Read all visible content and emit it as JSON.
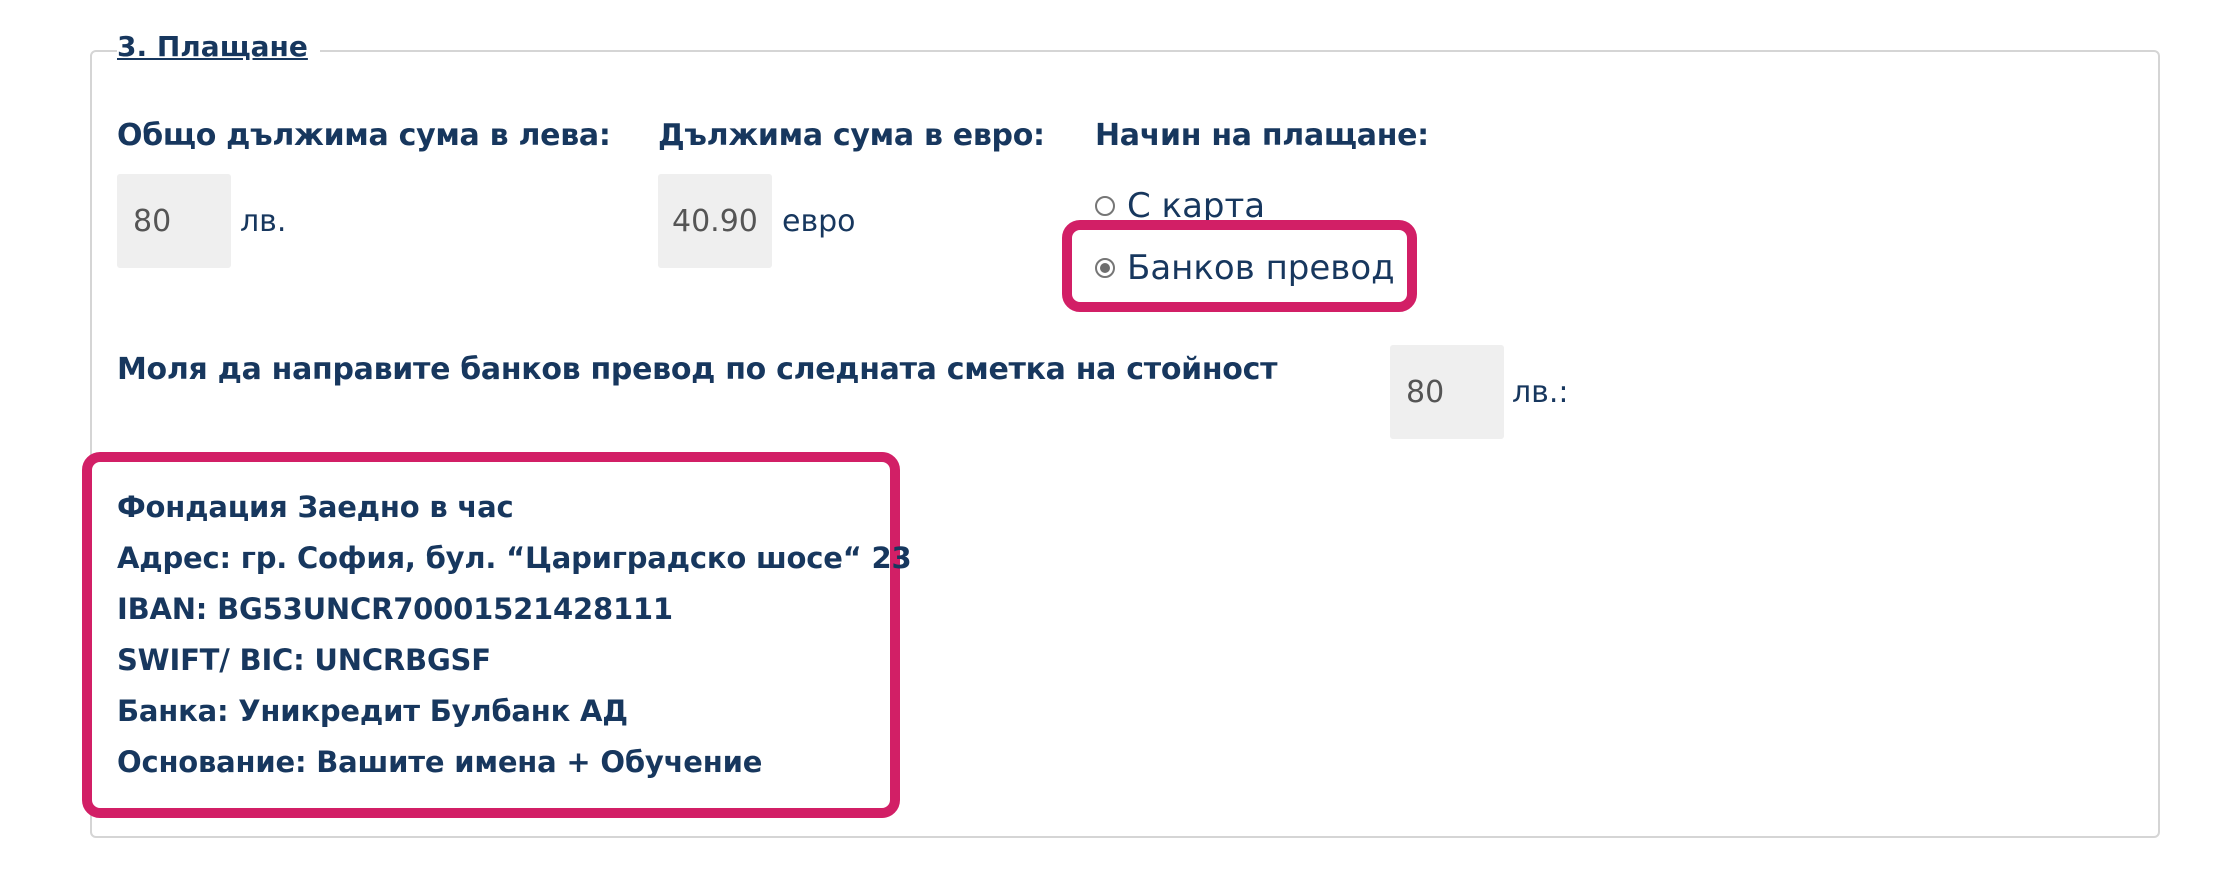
{
  "section": {
    "legend": "3. Плащане"
  },
  "amounts": {
    "total_bgn_label": "Общо дължима сума в лева:",
    "total_bgn_value": "80",
    "total_bgn_unit": "лв.",
    "total_eur_label": "Дължима сума в евро:",
    "total_eur_value": "40.90",
    "total_eur_unit": "евро"
  },
  "payment_method": {
    "label": "Начин на плащане:",
    "options": [
      {
        "label": "С карта",
        "checked": false
      },
      {
        "label": "Банков превод",
        "checked": true
      }
    ]
  },
  "transfer": {
    "instruction": "Моля да направите банков превод по следната сметка на стойност",
    "amount_value": "80",
    "amount_unit": "лв.:"
  },
  "bank_details": {
    "foundation": "Фондация Заедно в час",
    "address": "Адрес: гр. София, бул. “Цариградско шосе“ 23",
    "iban": "IBAN: BG53UNCR70001521428111",
    "swift": "SWIFT/ BIC: UNCRBGSF",
    "bank": "Банка: Уникредит Булбанк АД",
    "reason": "Основание: Вашите имена + Обучение"
  },
  "colors": {
    "text": "#17375e",
    "highlight": "#d21f66",
    "readonly_bg": "#efefef",
    "border": "#d5d5d5"
  }
}
